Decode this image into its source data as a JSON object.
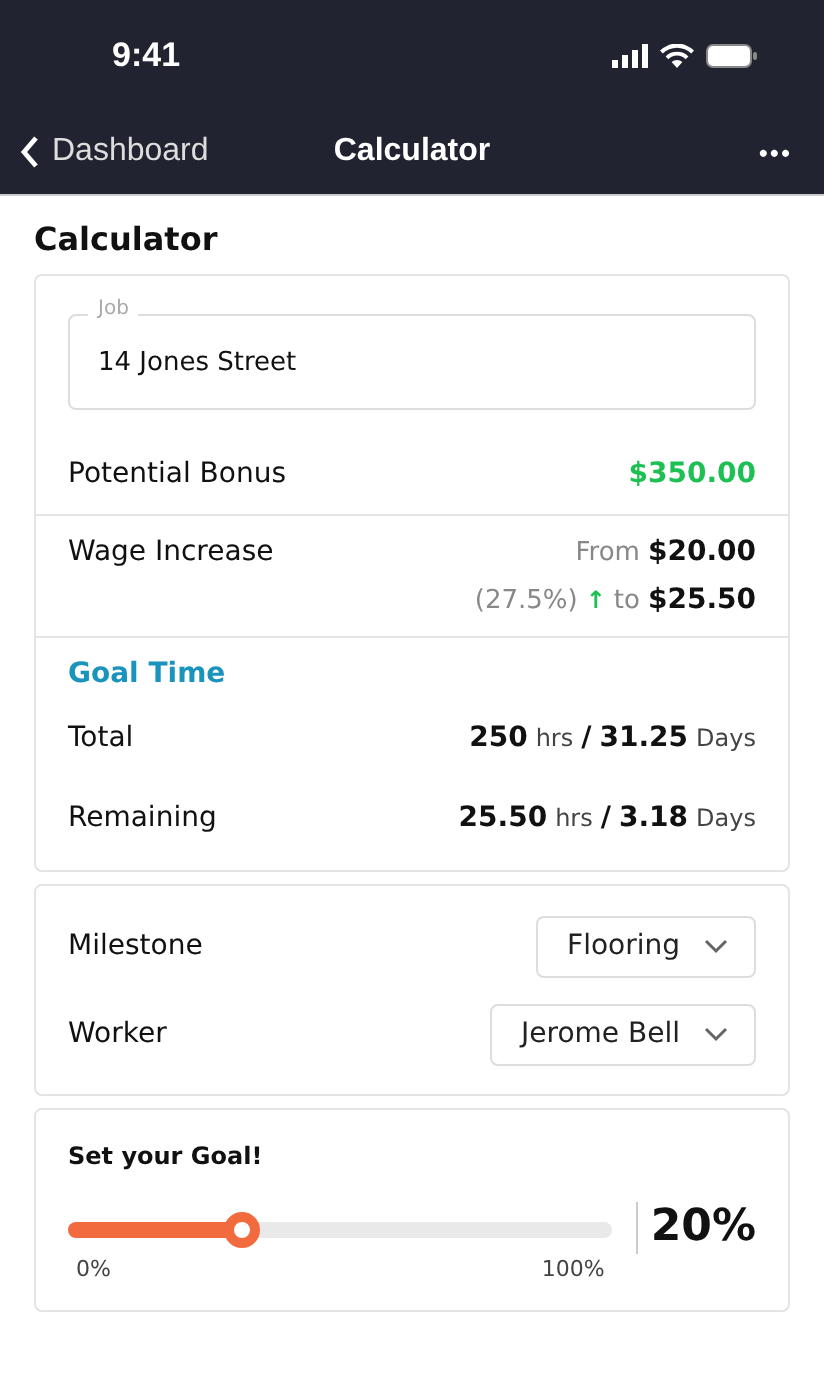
{
  "status_bar": {
    "time": "9:41"
  },
  "nav": {
    "back": "Dashboard",
    "title": "Calculator",
    "more": "•••"
  },
  "heading": "Calculator",
  "job": {
    "label": "Job",
    "value": "14 Jones Street"
  },
  "bonus": {
    "label": "Potential Bonus",
    "value": "$350.00"
  },
  "wage": {
    "label": "Wage Increase",
    "from_label": "From",
    "from": "$20.00",
    "percent": "(27.5%)",
    "arrow": "↑",
    "to_label": "to",
    "to": "$25.50"
  },
  "goal_time": {
    "title": "Goal Time",
    "rows": [
      {
        "label": "Total",
        "hours": "250",
        "hours_unit": "hrs",
        "sep": "/",
        "days": "31.25",
        "days_unit": "Days"
      },
      {
        "label": "Remaining",
        "hours": "25.50",
        "hours_unit": "hrs",
        "sep": "/",
        "days": "3.18",
        "days_unit": "Days"
      }
    ]
  },
  "selects": [
    {
      "label": "Milestone",
      "value": "Flooring"
    },
    {
      "label": "Worker",
      "value": "Jerome Bell"
    }
  ],
  "goal": {
    "title": "Set your Goal!",
    "level": 0.32,
    "min": "0%",
    "max": "100%",
    "reading": "20%"
  }
}
